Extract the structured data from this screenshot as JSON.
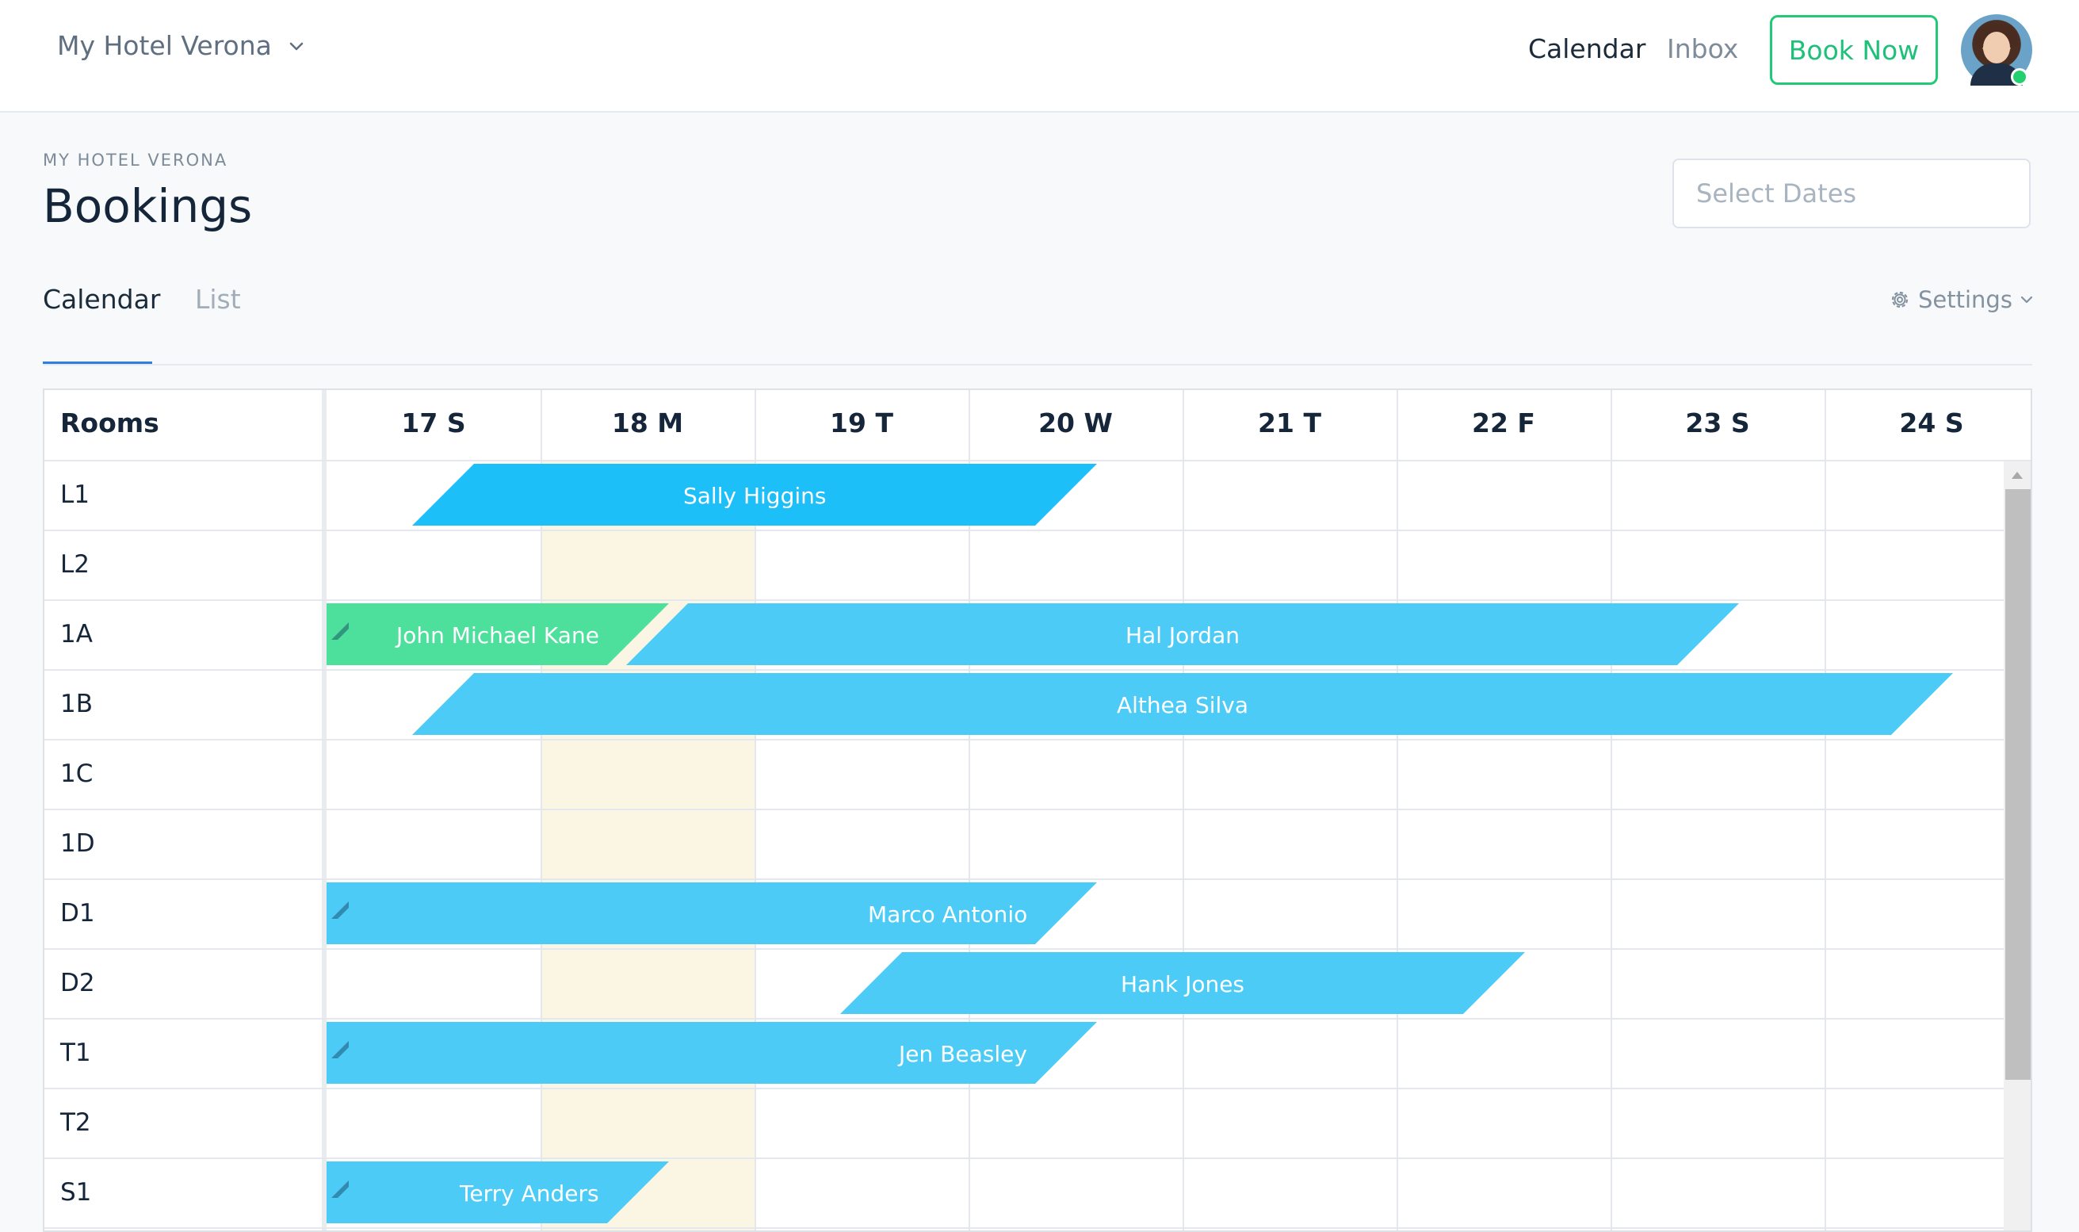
{
  "nav": {
    "hotel_name": "My Hotel Verona",
    "links": [
      "Calendar",
      "Inbox"
    ],
    "book_now": "Book Now"
  },
  "header": {
    "breadcrumb": "MY HOTEL VERONA",
    "title": "Bookings",
    "date_placeholder": "Select Dates",
    "tabs": [
      "Calendar",
      "List"
    ],
    "active_tab": "Calendar",
    "settings_label": "Settings"
  },
  "calendar": {
    "rooms_header": "Rooms",
    "days": [
      "17 S",
      "18 M",
      "19 T",
      "20 W",
      "21 T",
      "22 F",
      "23 S",
      "24 S"
    ],
    "highlighted_day": "18 M",
    "rooms": [
      "L1",
      "L2",
      "1A",
      "1B",
      "1C",
      "1D",
      "D1",
      "D2",
      "T1",
      "T2",
      "S1"
    ],
    "bookings": [
      {
        "guest": "Sally Higgins",
        "room": "L1",
        "start_day": 0.4,
        "end_day": 3.6,
        "color": "#1dbff8",
        "continued": false
      },
      {
        "guest": "John Michael Kane",
        "room": "1A",
        "start_day": 0,
        "end_day": 1.6,
        "color": "#4ddf9c",
        "continued": true
      },
      {
        "guest": "Hal Jordan",
        "room": "1A",
        "start_day": 1.4,
        "end_day": 6.6,
        "color": "#4ccbf7",
        "continued": false
      },
      {
        "guest": "Althea Silva",
        "room": "1B",
        "start_day": 0.4,
        "end_day": 7.6,
        "color": "#4ccbf7",
        "continued": false
      },
      {
        "guest": "Marco Antonio",
        "room": "D1",
        "start_day": 0,
        "end_day": 3.6,
        "color": "#4ccbf7",
        "continued": true
      },
      {
        "guest": "Hank Jones",
        "room": "D2",
        "start_day": 2.4,
        "end_day": 5.6,
        "color": "#4ccbf7",
        "continued": false
      },
      {
        "guest": "Jen Beasley",
        "room": "T1",
        "start_day": 0,
        "end_day": 3.6,
        "color": "#4ccbf7",
        "continued": true
      },
      {
        "guest": "Terry Anders",
        "room": "S1",
        "start_day": 0,
        "end_day": 1.6,
        "color": "#4ccbf7",
        "continued": true
      }
    ]
  },
  "icons": {
    "hotel_dropdown": "chevron-down-icon",
    "settings": "gear-icon",
    "settings_dropdown": "chevron-down-icon",
    "scroll_up": "caret-up-icon",
    "continued_booking": "fold-corner-icon"
  },
  "colors": {
    "accent_green": "#22c977",
    "booking_blue": "#4ccbf7",
    "booking_blue_active": "#1dbff8",
    "booking_green": "#4ddf9c",
    "highlight_day": "#fbf5e3",
    "tab_underline": "#2f7ee0"
  }
}
